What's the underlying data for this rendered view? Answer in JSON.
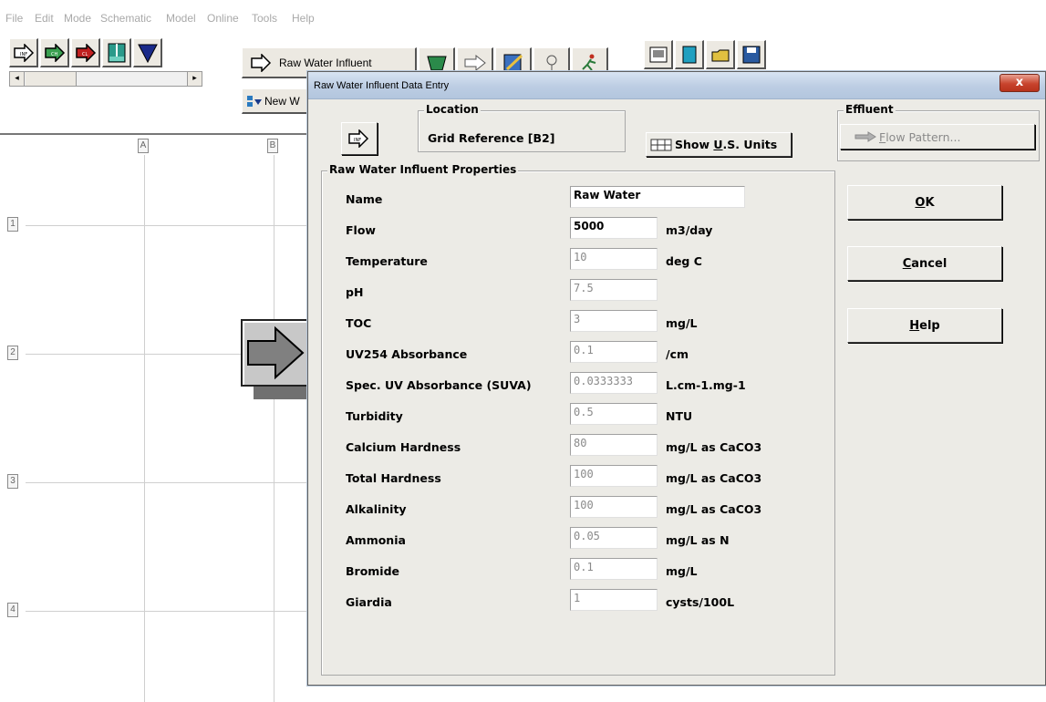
{
  "menu": [
    "File",
    "Edit",
    "Mode",
    "Schematic",
    "Model",
    "Online",
    "Tools",
    "Help"
  ],
  "toolbar": {
    "palette_icons": [
      "INF",
      "CH",
      "CL",
      "basin",
      "funnel"
    ],
    "raw_water_label": "Raw Water Influent",
    "new_label": "New W"
  },
  "grid": {
    "columns": [
      "A",
      "B"
    ],
    "rows": [
      "1",
      "2",
      "3",
      "4"
    ]
  },
  "dialog": {
    "title": "Raw Water Influent Data Entry",
    "close_label": "x",
    "location": {
      "title": "Location",
      "grid_reference": "Grid Reference [B2]",
      "icon_text": "INF"
    },
    "show_units": {
      "prefix": "Show ",
      "accel": "U",
      "rest": ".S. Units"
    },
    "effluent": {
      "title": "Effluent",
      "button_accel": "F",
      "button_rest": "low Pattern..."
    },
    "properties_title": "Raw Water Influent Properties",
    "properties": [
      {
        "label": "Name",
        "value": "Raw Water",
        "unit": ""
      },
      {
        "label": "Flow",
        "value": "5000",
        "unit": "m3/day"
      },
      {
        "label": "Temperature",
        "value": "10",
        "unit": "deg C"
      },
      {
        "label": "pH",
        "value": "7.5",
        "unit": ""
      },
      {
        "label": "TOC",
        "value": "3",
        "unit": "mg/L"
      },
      {
        "label": "UV254 Absorbance",
        "value": "0.1",
        "unit": "/cm"
      },
      {
        "label": "Spec. UV Absorbance (SUVA)",
        "value": "0.0333333",
        "unit": "L.cm-1.mg-1"
      },
      {
        "label": "Turbidity",
        "value": "0.5",
        "unit": "NTU"
      },
      {
        "label": "Calcium Hardness",
        "value": "80",
        "unit": "mg/L as CaCO3"
      },
      {
        "label": "Total Hardness",
        "value": "100",
        "unit": "mg/L as CaCO3"
      },
      {
        "label": "Alkalinity",
        "value": "100",
        "unit": "mg/L as CaCO3"
      },
      {
        "label": "Ammonia",
        "value": "0.05",
        "unit": "mg/L as N"
      },
      {
        "label": "Bromide",
        "value": "0.1",
        "unit": "mg/L"
      },
      {
        "label": "Giardia",
        "value": "1",
        "unit": "cysts/100L"
      }
    ],
    "buttons": {
      "ok_accel": "O",
      "ok_rest": "K",
      "cancel_accel": "C",
      "cancel_rest": "ancel",
      "help_accel": "H",
      "help_rest": "elp"
    }
  }
}
